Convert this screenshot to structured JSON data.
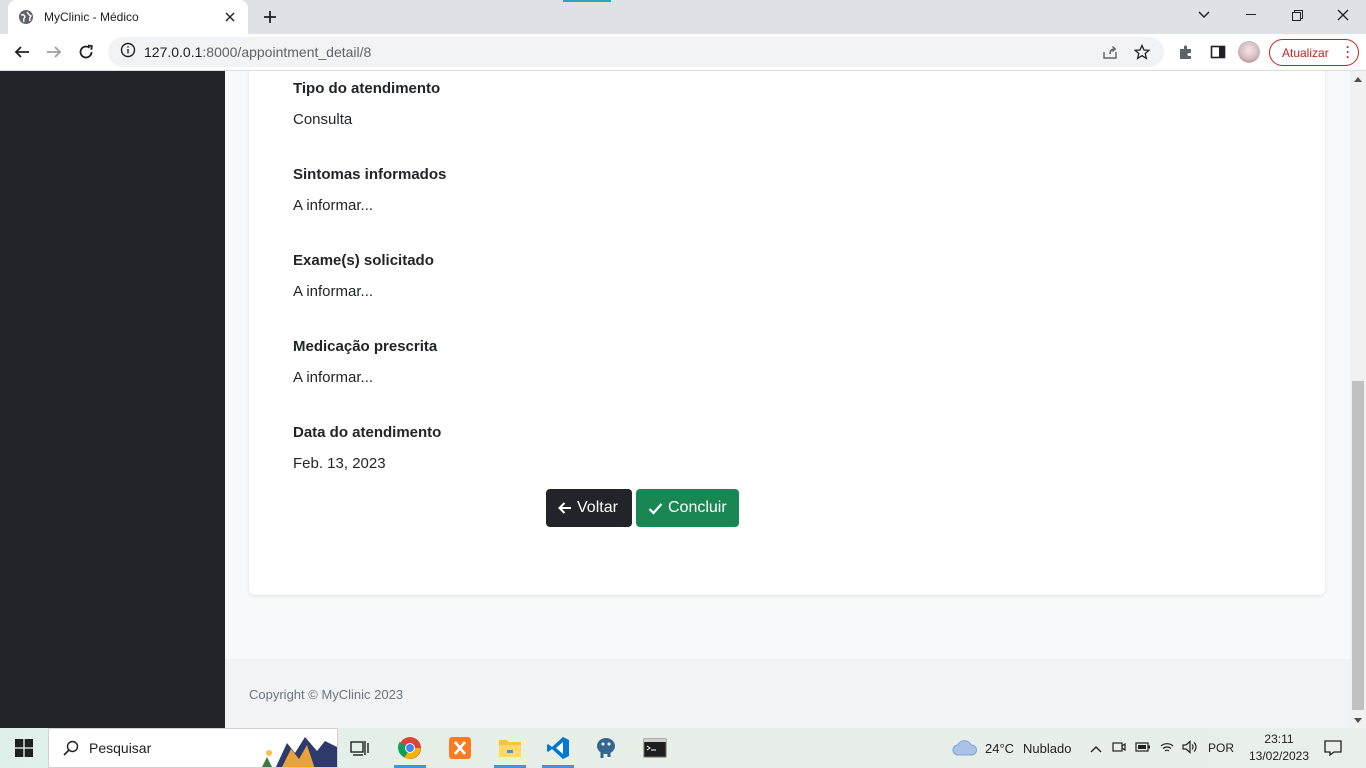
{
  "browser": {
    "tab_title": "MyClinic - Médico",
    "url_host": "127.0.0.1",
    "url_rest": ":8000/appointment_detail/8",
    "update_label": "Atualizar"
  },
  "details": [
    {
      "label": "Tipo do atendimento",
      "value": "Consulta"
    },
    {
      "label": "Sintomas informados",
      "value": "A informar..."
    },
    {
      "label": "Exame(s) solicitado",
      "value": "A informar..."
    },
    {
      "label": "Medicação prescrita",
      "value": "A informar..."
    },
    {
      "label": "Data do atendimento",
      "value": "Feb. 13, 2023"
    }
  ],
  "buttons": {
    "back_label": "Voltar",
    "complete_label": "Concluir"
  },
  "footer": {
    "copyright": "Copyright © MyClinic 2023"
  },
  "taskbar": {
    "search_placeholder": "Pesquisar",
    "weather_temp": "24°C",
    "weather_desc": "Nublado",
    "language": "POR",
    "time": "23:11",
    "date": "13/02/2023"
  },
  "colors": {
    "sidebar": "#212529",
    "btn_dark": "#212529",
    "btn_success": "#198754",
    "update_red": "#c5221f"
  }
}
